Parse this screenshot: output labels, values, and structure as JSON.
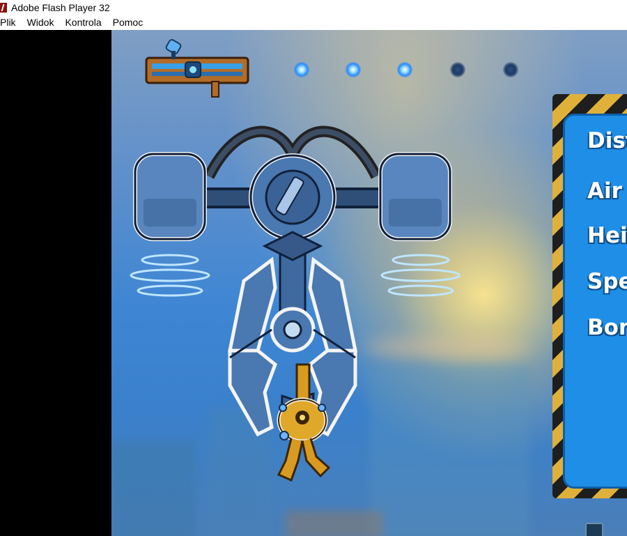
{
  "window": {
    "title": "Adobe Flash Player 32",
    "icon": "flash-player-icon"
  },
  "menu": {
    "items": [
      "Plik",
      "Widok",
      "Kontrola",
      "Pomoc"
    ]
  },
  "hud": {
    "weapon_icon": "blaster-gun-icon",
    "ammo_total": 5,
    "ammo_lit": 3
  },
  "stats_panel": {
    "labels": [
      "Dist",
      "Air",
      "Heig",
      "Spec",
      "Bon"
    ]
  },
  "colors": {
    "panel": "#1f8ee6",
    "ammo_lit": "#2a8cff",
    "claw_metal": "#4a78b0"
  }
}
